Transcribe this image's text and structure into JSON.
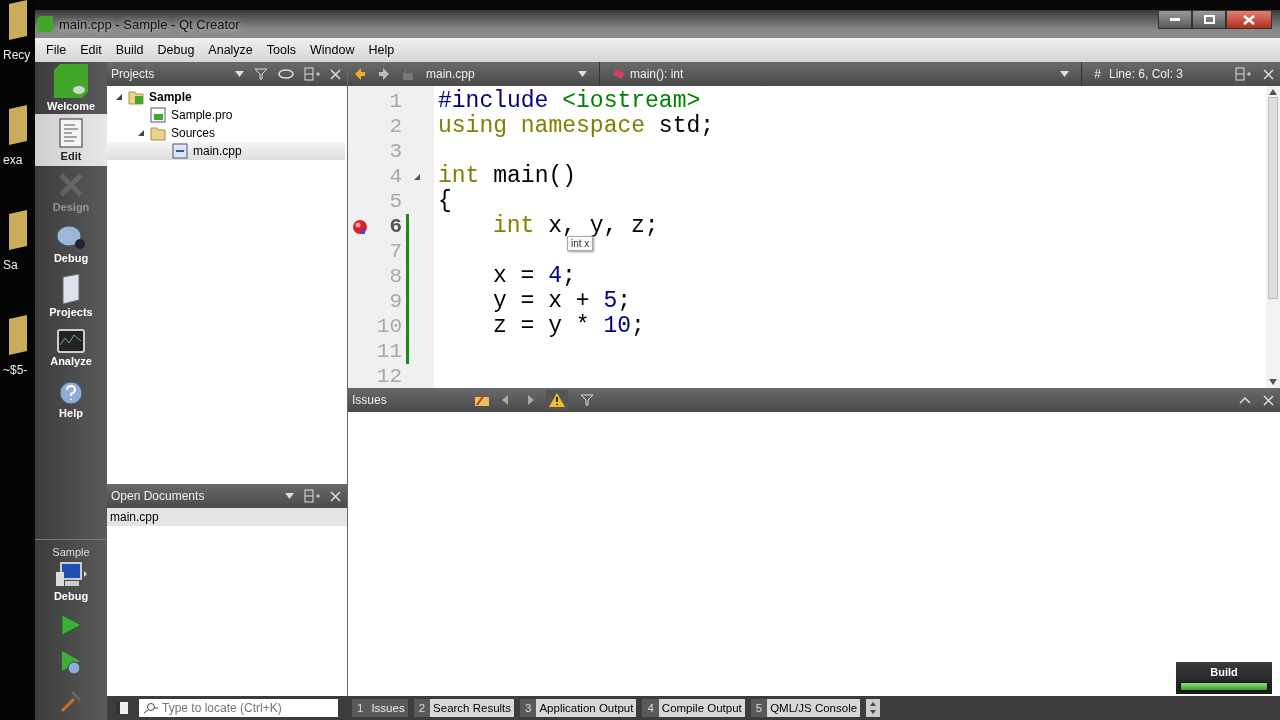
{
  "desktop_icons": [
    {
      "label": "Recy"
    },
    {
      "label": "exa"
    },
    {
      "label": "Sa"
    },
    {
      "label": "~$5-"
    }
  ],
  "window": {
    "title": "main.cpp - Sample - Qt Creator"
  },
  "menu": [
    "File",
    "Edit",
    "Build",
    "Debug",
    "Analyze",
    "Tools",
    "Window",
    "Help"
  ],
  "mode_bar": {
    "items": [
      {
        "label": "Welcome",
        "selected": false,
        "disabled": false
      },
      {
        "label": "Edit",
        "selected": true,
        "disabled": false
      },
      {
        "label": "Design",
        "selected": false,
        "disabled": true
      },
      {
        "label": "Debug",
        "selected": false,
        "disabled": false
      },
      {
        "label": "Projects",
        "selected": false,
        "disabled": false
      },
      {
        "label": "Analyze",
        "selected": false,
        "disabled": false
      },
      {
        "label": "Help",
        "selected": false,
        "disabled": false
      }
    ],
    "kit": {
      "project": "Sample",
      "build": "Debug"
    }
  },
  "projects_panel": {
    "title": "Projects",
    "tree": [
      {
        "label": "Sample",
        "kind": "project",
        "expanded": true,
        "selected": false,
        "children": [
          {
            "label": "Sample.pro",
            "kind": "pro",
            "selected": false
          },
          {
            "label": "Sources",
            "kind": "folder",
            "expanded": true,
            "selected": false,
            "children": [
              {
                "label": "main.cpp",
                "kind": "cpp",
                "selected": true
              }
            ]
          }
        ]
      }
    ]
  },
  "open_documents": {
    "title": "Open Documents",
    "items": [
      {
        "label": "main.cpp",
        "selected": true
      }
    ]
  },
  "editor": {
    "file": "main.cpp",
    "symbol": "main(): int",
    "line_marker": "#",
    "position": "Line: 6, Col: 3",
    "tooltip": "int x",
    "lines": [
      {
        "number": "1",
        "indented": false,
        "current": false,
        "breakpoint": false,
        "changed": false,
        "fold": false,
        "tokens": [
          {
            "kind": "preproc",
            "text": "#include"
          },
          {
            "kind": "include",
            "text": " <iostream>"
          }
        ]
      },
      {
        "number": "2",
        "indented": false,
        "current": false,
        "breakpoint": false,
        "changed": false,
        "fold": false,
        "tokens": [
          {
            "kind": "keyword",
            "text": "using namespace"
          },
          {
            "kind": "plain",
            "text": " std;"
          }
        ]
      },
      {
        "number": "3",
        "current": false,
        "breakpoint": false,
        "changed": false,
        "fold": false
      },
      {
        "number": "4",
        "indented": false,
        "current": false,
        "breakpoint": false,
        "changed": false,
        "fold": true,
        "tokens": [
          {
            "kind": "keyword",
            "text": "int"
          },
          {
            "kind": "plain",
            "text": " main()"
          }
        ]
      },
      {
        "number": "5",
        "indented": false,
        "current": false,
        "breakpoint": false,
        "changed": false,
        "fold": false,
        "tokens": [
          {
            "kind": "plain",
            "text": "{"
          }
        ]
      },
      {
        "number": "6",
        "indented": true,
        "current": true,
        "breakpoint": true,
        "changed": true,
        "fold": false,
        "tokens": [
          {
            "kind": "keyword",
            "text": "int"
          },
          {
            "kind": "plain",
            "text": " x, y, z;"
          }
        ]
      },
      {
        "number": "7",
        "current": false,
        "breakpoint": false,
        "changed": true,
        "fold": false
      },
      {
        "number": "8",
        "indented": true,
        "current": false,
        "breakpoint": false,
        "changed": true,
        "fold": false,
        "tokens": [
          {
            "kind": "plain",
            "text": "x = "
          },
          {
            "kind": "number",
            "text": "4"
          },
          {
            "kind": "plain",
            "text": ";"
          }
        ]
      },
      {
        "number": "9",
        "indented": true,
        "current": false,
        "breakpoint": false,
        "changed": true,
        "fold": false,
        "tokens": [
          {
            "kind": "plain",
            "text": "y = x + "
          },
          {
            "kind": "number",
            "text": "5"
          },
          {
            "kind": "plain",
            "text": ";"
          }
        ]
      },
      {
        "number": "10",
        "indented": true,
        "current": false,
        "breakpoint": false,
        "changed": true,
        "fold": false,
        "tokens": [
          {
            "kind": "plain",
            "text": "z = y * "
          },
          {
            "kind": "number",
            "text": "10"
          },
          {
            "kind": "plain",
            "text": ";"
          }
        ]
      },
      {
        "number": "11",
        "current": false,
        "breakpoint": false,
        "changed": true,
        "fold": false
      },
      {
        "number": "12",
        "current": false,
        "breakpoint": false,
        "changed": false,
        "fold": false
      }
    ]
  },
  "issues_panel": {
    "title": "Issues"
  },
  "locator": {
    "placeholder": "Type to locate (Ctrl+K)"
  },
  "output_tabs": [
    {
      "number": "1",
      "label": "Issues",
      "selected": true
    },
    {
      "number": "2",
      "label": "Search Results",
      "selected": false
    },
    {
      "number": "3",
      "label": "Application Output",
      "selected": false
    },
    {
      "number": "4",
      "label": "Compile Output",
      "selected": false
    },
    {
      "number": "5",
      "label": "QML/JS Console",
      "selected": false
    }
  ],
  "build": {
    "label": "Build",
    "level": 1
  }
}
